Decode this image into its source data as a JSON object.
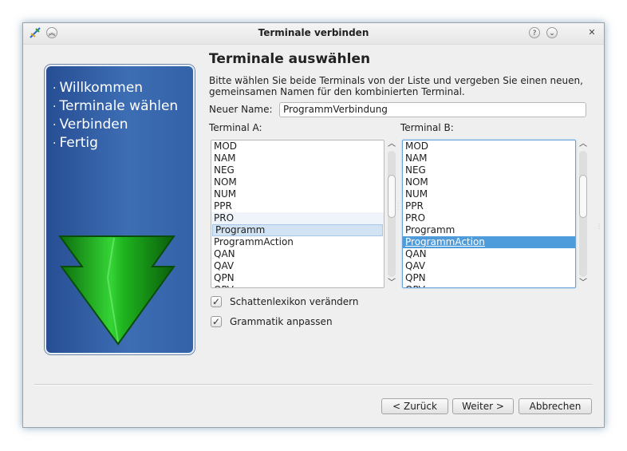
{
  "window": {
    "title": "Terminale verbinden"
  },
  "titlebar_buttons": [
    {
      "icon": "help-icon",
      "glyph": "?"
    },
    {
      "icon": "minimize-icon",
      "glyph": "v"
    },
    {
      "icon": "close-icon",
      "glyph": "x"
    }
  ],
  "sidebar": {
    "steps": [
      "Willkommen",
      "Terminale wählen",
      "Verbinden",
      "Fertig"
    ]
  },
  "page": {
    "heading": "Terminale auswählen",
    "description": "Bitte wählen Sie beide Terminals von der Liste und vergeben Sie einen neuen, gemeinsamen Namen für den kombinierten Terminal."
  },
  "name_field": {
    "label": "Neuer Name:",
    "value": "ProgrammVerbindung"
  },
  "terminal_a": {
    "label": "Terminal A:",
    "items": [
      "MOD",
      "NAM",
      "NEG",
      "NOM",
      "NUM",
      "PPR",
      "PRO",
      "Programm",
      "ProgrammAction",
      "QAN",
      "QAV",
      "QPN",
      "QPV"
    ],
    "selected": "Programm",
    "hovered": "PRO"
  },
  "terminal_b": {
    "label": "Terminal B:",
    "items": [
      "MOD",
      "NAM",
      "NEG",
      "NOM",
      "NUM",
      "PPR",
      "PRO",
      "Programm",
      "ProgrammAction",
      "QAN",
      "QAV",
      "QPN",
      "QPV"
    ],
    "selected": "ProgrammAction"
  },
  "checkboxes": [
    {
      "label": "Schattenlexikon verändern",
      "checked": true
    },
    {
      "label": "Grammatik anpassen",
      "checked": true
    }
  ],
  "buttons": {
    "back": "< Zurück",
    "next": "Weiter >",
    "cancel": "Abbrechen"
  },
  "colors": {
    "sidebar": "#2f5ea6",
    "selection": "#4f9cdc",
    "arrow": "#1fb51f"
  }
}
